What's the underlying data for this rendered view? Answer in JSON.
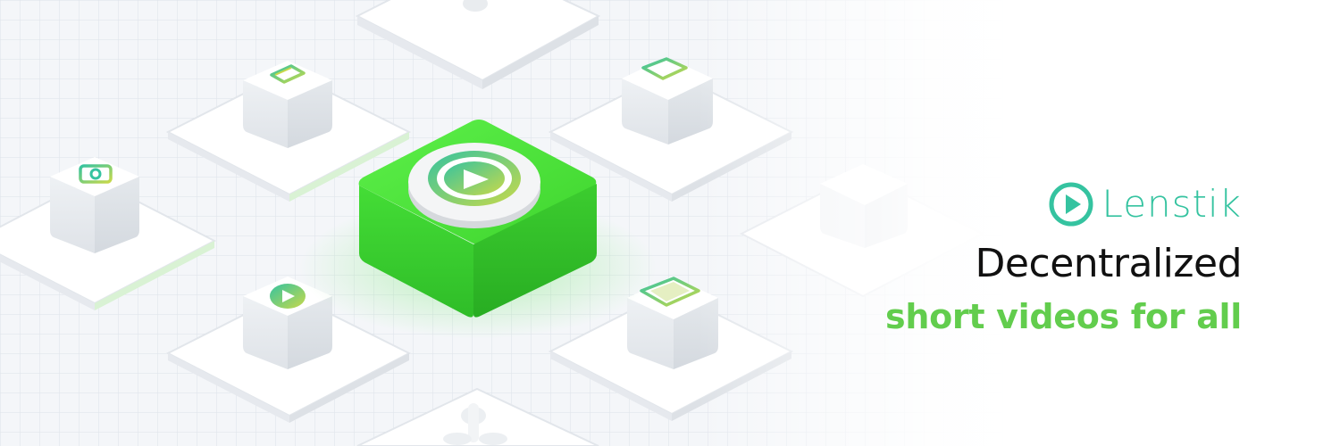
{
  "brand": {
    "name": "Lenstik",
    "tagline": "Decentralized",
    "subline": "short videos for all"
  },
  "colors": {
    "logo": "#35c3a0",
    "subline": "#62cd4d",
    "tagline": "#111111",
    "hero_block": "#4be03a",
    "tile": "#ffffff",
    "grid": "#dfe4ea"
  },
  "icons": {
    "center": "play-button-icon",
    "blocks": [
      "tablet-icon",
      "phone-icon",
      "camera-icon",
      "play-icon",
      "film-strip-icon",
      "blank-block"
    ]
  }
}
